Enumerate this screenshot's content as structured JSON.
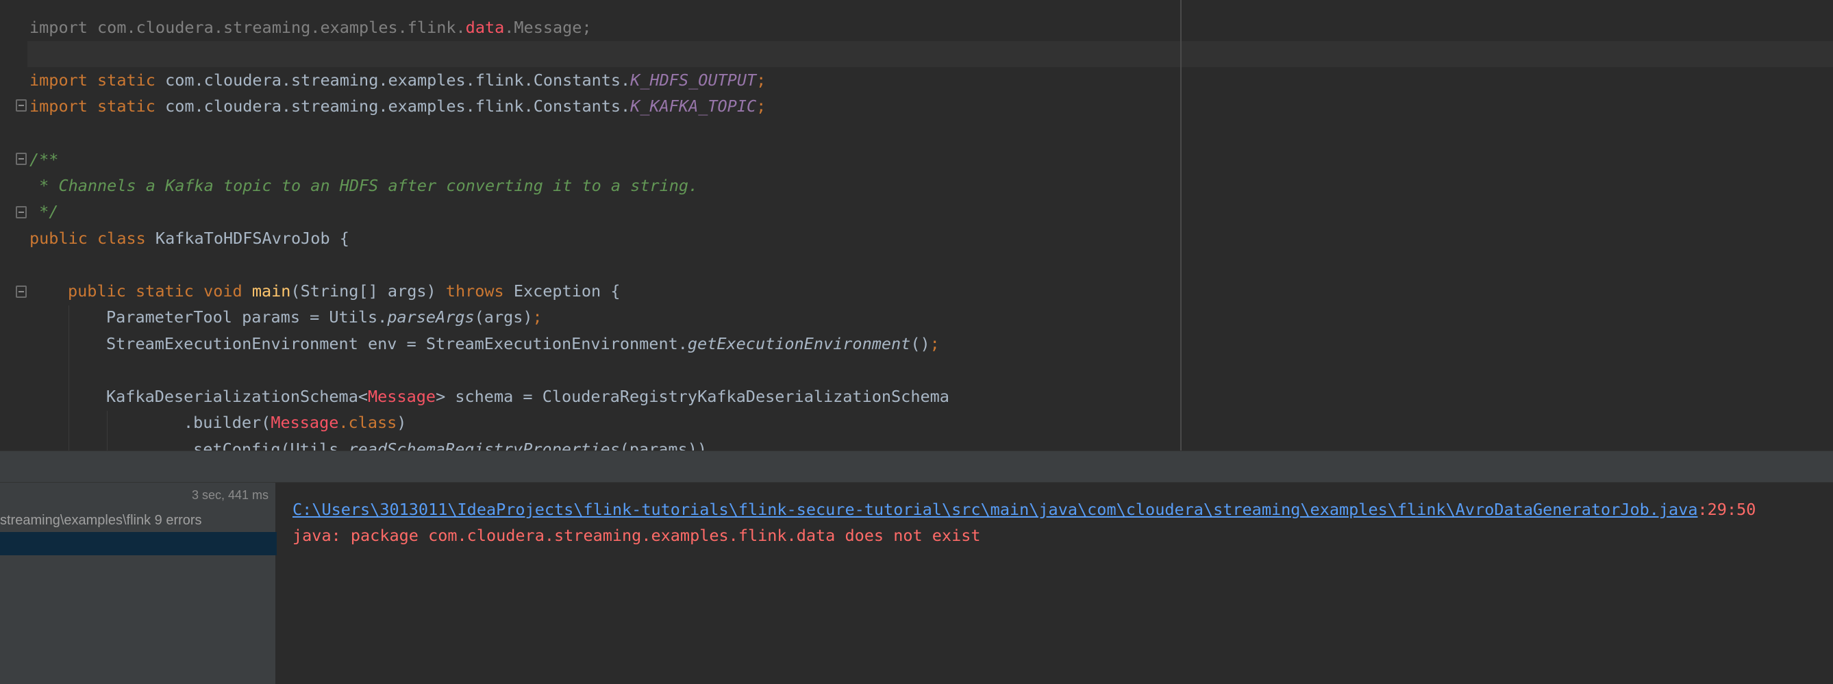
{
  "editor": {
    "lines": {
      "import_message": {
        "kw": "import",
        "pkg": " com.cloudera.streaming.examples.flink.",
        "err_part": "data",
        "tail": ".Message",
        "semi": ";"
      },
      "import_hdfs": {
        "kw": "import static",
        "pkg": " com.cloudera.streaming.examples.flink.Constants.",
        "const": "K_HDFS_OUTPUT",
        "semi": ";"
      },
      "import_kafka": {
        "kw": "import static",
        "pkg": " com.cloudera.streaming.examples.flink.Constants.",
        "const": "K_KAFKA_TOPIC",
        "semi": ";"
      },
      "doc_open": "/**",
      "doc_body": " * Channels a Kafka topic to an HDFS after converting it to a string.",
      "doc_close": " */",
      "class_decl": {
        "kw": "public class",
        "name": " KafkaToHDFSAvroJob {"
      },
      "main_decl": {
        "kw1": "public static void",
        "fn": "main",
        "params": "(String[] args) ",
        "kw2": "throws",
        "tail": " Exception {"
      },
      "params_line": {
        "head": "ParameterTool params = Utils.",
        "call": "parseArgs",
        "tail": "(args)",
        "semi": ";"
      },
      "env_line": {
        "head": "StreamExecutionEnvironment env = StreamExecutionEnvironment.",
        "call": "getExecutionEnvironment",
        "tail": "()",
        "semi": ";"
      },
      "schema_line": {
        "head": "KafkaDeserializationSchema<",
        "generic": "Message",
        "tail": "> schema = ClouderaRegistryKafkaDeserializationSchema"
      },
      "builder_line": {
        "head": ".builder(",
        "cls": "Message",
        "kw": ".class",
        "tail": ")"
      },
      "config_line": {
        "head": ".setConfig(Utils.",
        "call": "readSchemaRegistryProperties",
        "tail": "(params))"
      }
    }
  },
  "build": {
    "tree": {
      "time": "3 sec, 441 ms",
      "path_row": "streaming\\examples\\flink 9 errors"
    },
    "output": {
      "file_link": "C:\\Users\\3013011\\IdeaProjects\\flink-tutorials\\flink-secure-tutorial\\src\\main\\java\\com\\cloudera\\streaming\\examples\\flink\\AvroDataGeneratorJob.java",
      "location": ":29:50",
      "error_message": "java: package com.cloudera.streaming.examples.flink.data does not exist"
    }
  },
  "colors": {
    "editor_bg": "#2b2b2b",
    "keyword": "#cc7832",
    "function": "#ffc66d",
    "constant": "#9876aa",
    "doc_comment": "#629755",
    "error": "#f75464",
    "link": "#589df6"
  }
}
